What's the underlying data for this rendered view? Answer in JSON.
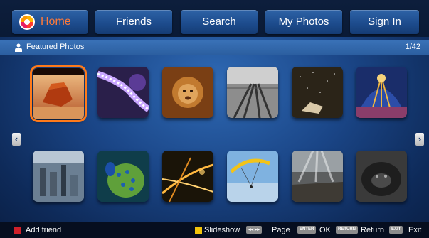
{
  "nav": {
    "tabs": [
      {
        "label": "Home",
        "active": true
      },
      {
        "label": "Friends"
      },
      {
        "label": "Search"
      },
      {
        "label": "My Photos"
      },
      {
        "label": "Sign In"
      }
    ]
  },
  "section": {
    "title": "Featured Photos",
    "counter": "1/42"
  },
  "photos": [
    {
      "subject": "red rock desert"
    },
    {
      "subject": "purple light trail"
    },
    {
      "subject": "lion cub"
    },
    {
      "subject": "railway tracks"
    },
    {
      "subject": "night sky meteor"
    },
    {
      "subject": "ornate dome"
    },
    {
      "subject": "city skyline aerial"
    },
    {
      "subject": "peacock"
    },
    {
      "subject": "city lights at night"
    },
    {
      "subject": "paraglider"
    },
    {
      "subject": "sunbeams over landscape"
    },
    {
      "subject": "gorilla"
    }
  ],
  "footer": {
    "add_friend": "Add friend",
    "slideshow": "Slideshow",
    "page_keys": "◂◂ ▸▸",
    "page": "Page",
    "enter_key": "ENTER",
    "ok": "OK",
    "return_key": "RETURN",
    "return": "Return",
    "exit_key": "EXIT",
    "exit": "Exit"
  },
  "colors": {
    "accent": "#ff7a1a",
    "red": "#d0202a",
    "yellow": "#f2c40b"
  }
}
